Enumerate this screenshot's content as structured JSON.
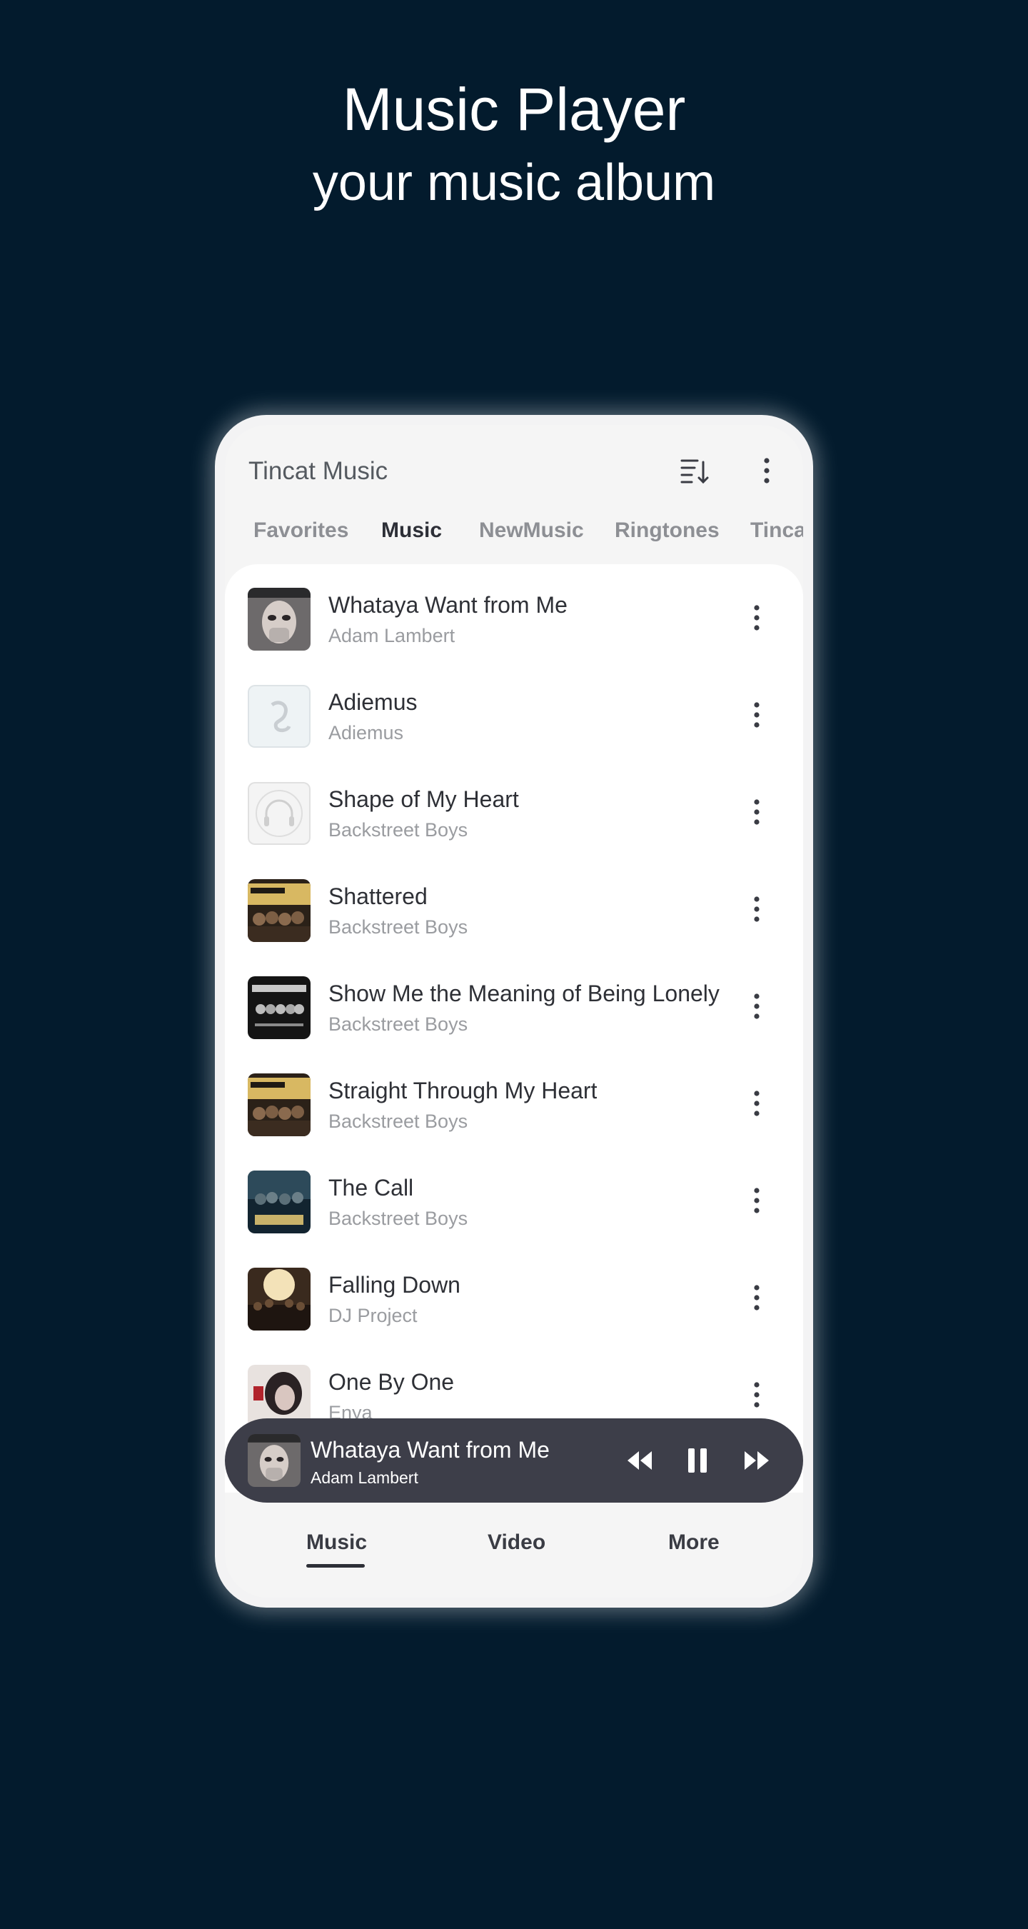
{
  "hero": {
    "title": "Music Player",
    "subtitle": "your music album"
  },
  "app": {
    "title": "Tincat Music",
    "header_icons": [
      "sort-list-icon",
      "more-vertical-icon"
    ]
  },
  "tabs": [
    {
      "label": "Favorites",
      "active": false
    },
    {
      "label": "Music",
      "active": true
    },
    {
      "label": "NewMusic",
      "active": false
    },
    {
      "label": "Ringtones",
      "active": false
    },
    {
      "label": "Tinca",
      "active": false
    }
  ],
  "songs": [
    {
      "title": "Whataya Want from Me",
      "artist": "Adam Lambert"
    },
    {
      "title": "Adiemus",
      "artist": "Adiemus"
    },
    {
      "title": "Shape of My Heart",
      "artist": "Backstreet Boys"
    },
    {
      "title": "Shattered",
      "artist": "Backstreet Boys"
    },
    {
      "title": "Show Me the Meaning of Being Lonely",
      "artist": "Backstreet Boys"
    },
    {
      "title": "Straight Through My Heart",
      "artist": "Backstreet Boys"
    },
    {
      "title": "The Call",
      "artist": "Backstreet Boys"
    },
    {
      "title": "Falling Down",
      "artist": "DJ Project"
    },
    {
      "title": "One By One",
      "artist": "Enya"
    }
  ],
  "now_playing": {
    "title": "Whataya Want from Me",
    "artist": "Adam Lambert",
    "controls": [
      "rewind-icon",
      "pause-icon",
      "fast-forward-icon"
    ]
  },
  "bottom_nav": [
    {
      "label": "Music",
      "active": true
    },
    {
      "label": "Video",
      "active": false
    },
    {
      "label": "More",
      "active": false
    }
  ],
  "colors": {
    "background": "#031b2d",
    "phone": "#f3f3f4",
    "list_background": "#ffffff",
    "mini_player": "#3d3e49",
    "active_text": "#2d2f37",
    "inactive_tab": "#8d8f94"
  }
}
